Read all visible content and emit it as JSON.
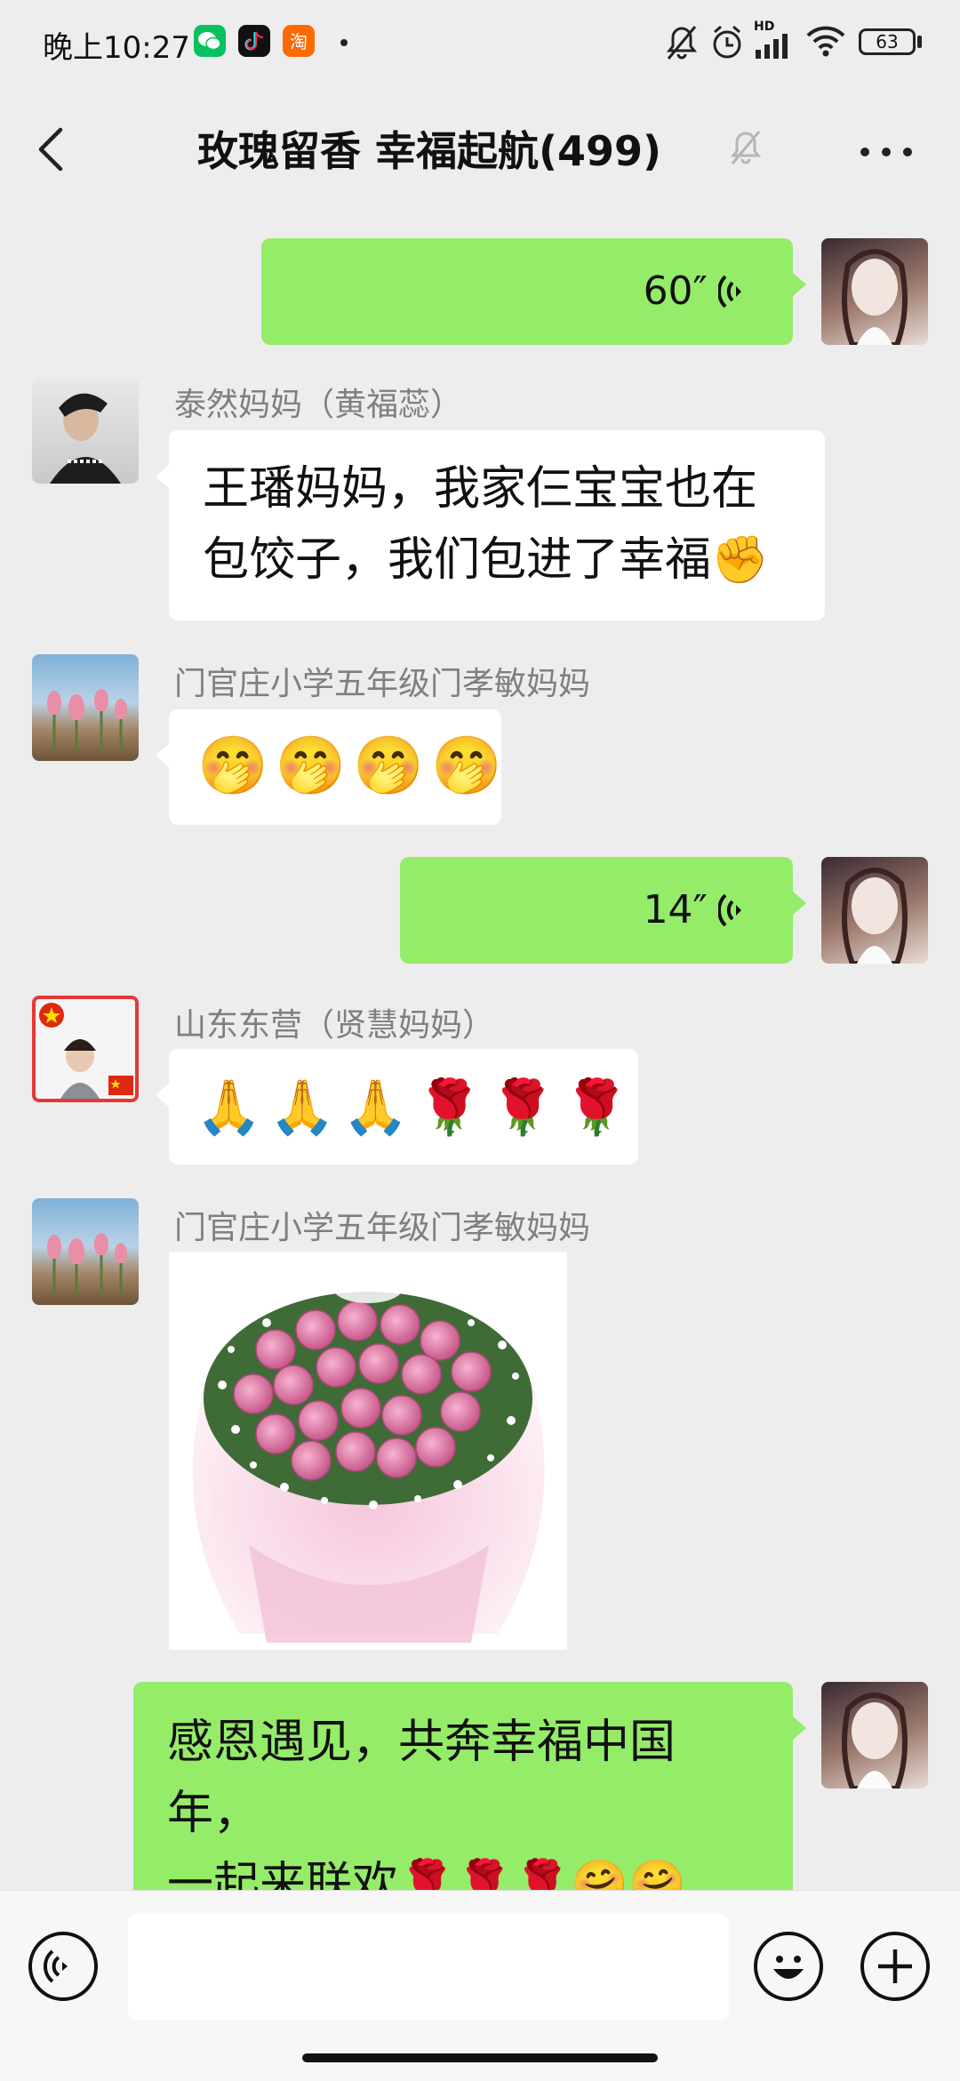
{
  "status_bar": {
    "time": "晚上10:27",
    "battery": "63",
    "network": "HD",
    "icons": [
      "wechat-icon",
      "tiktok-icon",
      "taobao-icon",
      "mute-bell-icon",
      "alarm-icon",
      "signal-icon",
      "wifi-icon",
      "battery-icon"
    ]
  },
  "header": {
    "title": "玫瑰留香  幸福起航(499)",
    "icons": [
      "back-icon",
      "mute-bell-icon",
      "more-icon"
    ]
  },
  "messages": [
    {
      "type": "voice",
      "direction": "out",
      "duration": "60″"
    },
    {
      "type": "text",
      "direction": "in",
      "sender": "泰然妈妈（黄福蕊）",
      "lines": [
        "王璠妈妈，我家仨宝宝也在",
        "包饺子，我们包进了幸福✊"
      ]
    },
    {
      "type": "emoji",
      "direction": "in",
      "sender": "门官庄小学五年级门孝敏妈妈",
      "content": "🤭🤭🤭🤭"
    },
    {
      "type": "voice",
      "direction": "out",
      "duration": "14″"
    },
    {
      "type": "emoji",
      "direction": "in",
      "sender": "山东东营（贤慧妈妈）",
      "content": "🙏🙏🙏🌹🌹🌹"
    },
    {
      "type": "image",
      "direction": "in",
      "sender": "门官庄小学五年级门孝敏妈妈",
      "image": "pink-rose-bouquet"
    },
    {
      "type": "text",
      "direction": "out",
      "lines": [
        "感恩遇见，共奔幸福中国年，",
        "一起来联欢🌹🌹🌹🤗🤗",
        "😶"
      ]
    }
  ],
  "input_bar": {
    "placeholder": "",
    "icons": [
      "voice-mode-icon",
      "emoji-icon",
      "plus-icon"
    ]
  },
  "colors": {
    "background": "#EDEDED",
    "out_bubble": "#95EC69",
    "in_bubble": "#FFFFFF"
  }
}
